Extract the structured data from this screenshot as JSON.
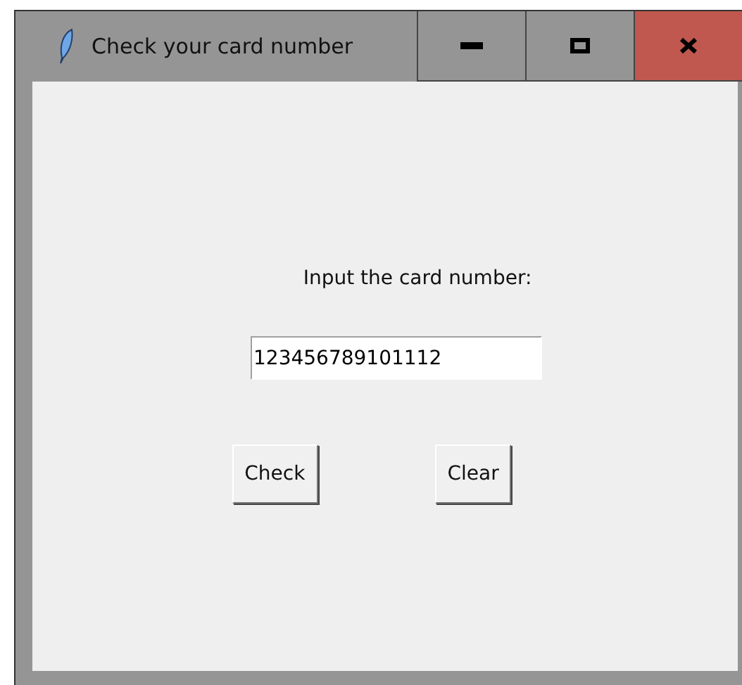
{
  "window": {
    "title": "Check your card number",
    "controls": [
      {
        "kind": "minimize"
      },
      {
        "kind": "maximize"
      },
      {
        "kind": "close"
      }
    ]
  },
  "form": {
    "label": "Input the card number:",
    "card_number": "123456789101112",
    "buttons": [
      "Check",
      "Clear"
    ]
  }
}
